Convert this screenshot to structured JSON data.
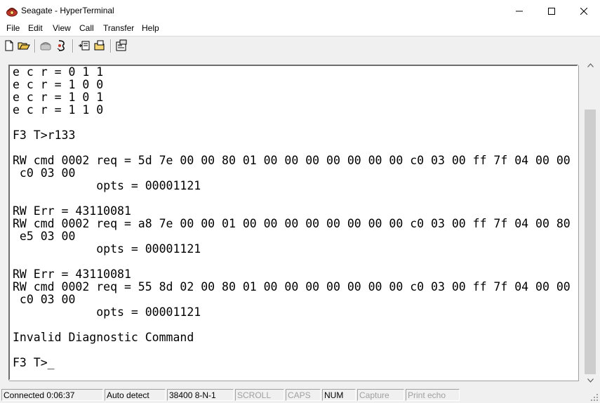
{
  "window": {
    "title": "Seagate - HyperTerminal",
    "icon": "hyperterminal-phone-icon",
    "controls": [
      "minimize-icon",
      "maximize-icon",
      "close-icon"
    ]
  },
  "menu": {
    "items": [
      "File",
      "Edit",
      "View",
      "Call",
      "Transfer",
      "Help"
    ]
  },
  "toolbar": {
    "buttons": [
      "new-icon",
      "open-icon",
      "call-icon",
      "disconnect-icon",
      "send-icon",
      "receive-icon",
      "properties-icon"
    ]
  },
  "terminal": {
    "lines": [
      "e c r = 0 1 1",
      "e c r = 1 0 0",
      "e c r = 1 0 1",
      "e c r = 1 1 0",
      "",
      "F3 T>r133",
      "",
      "RW cmd 0002 req = 5d 7e 00 00 80 01 00 00 00 00 00 00 00 c0 03 00 ff 7f 04 00 00",
      " c0 03 00",
      "            opts = 00001121",
      "",
      "RW Err = 43110081",
      "RW cmd 0002 req = a8 7e 00 00 01 00 00 00 00 00 00 00 00 c0 03 00 ff 7f 04 00 80",
      " e5 03 00",
      "            opts = 00001121",
      "",
      "RW Err = 43110081",
      "RW cmd 0002 req = 55 8d 02 00 80 01 00 00 00 00 00 00 00 c0 03 00 ff 7f 04 00 00",
      " c0 03 00",
      "            opts = 00001121",
      "",
      "Invalid Diagnostic Command",
      "",
      "F3 T>_"
    ]
  },
  "status": {
    "connected": "Connected 0:06:37",
    "detect": "Auto detect",
    "settings": "38400 8-N-1",
    "scroll": "SCROLL",
    "caps": "CAPS",
    "num": "NUM",
    "capture": "Capture",
    "print_echo": "Print echo"
  }
}
